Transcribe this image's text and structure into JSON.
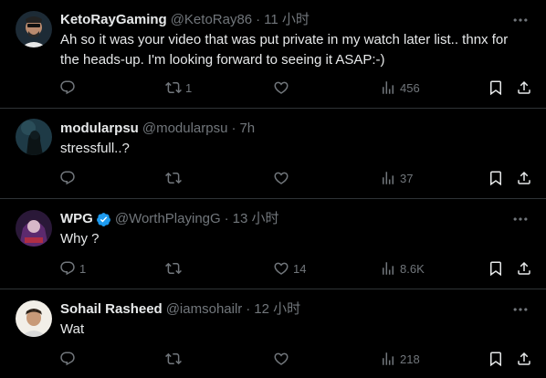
{
  "tweets": [
    {
      "name": "KetoRayGaming",
      "handle": "@KetoRay86",
      "separator": "·",
      "time": "11 小时",
      "text": "Ah so it was your video that was put private in my watch later list.. thnx for\nthe heads-up. I'm looking forward to seeing it ASAP:-)",
      "verified": false,
      "reply_count": "",
      "retweet_count": "1",
      "like_count": "",
      "view_count": "456"
    },
    {
      "name": "modularpsu",
      "handle": "@modularpsu",
      "separator": "·",
      "time": "7h",
      "text": "stressfull..?",
      "verified": false,
      "reply_count": "",
      "retweet_count": "",
      "like_count": "",
      "view_count": "37"
    },
    {
      "name": "WPG",
      "handle": "@WorthPlayingG",
      "separator": "·",
      "time": "13 小时",
      "text": "Why ?",
      "verified": true,
      "reply_count": "1",
      "retweet_count": "",
      "like_count": "14",
      "view_count": "8.6K"
    },
    {
      "name": "Sohail Rasheed",
      "handle": "@iamsohailr",
      "separator": "·",
      "time": "12 小时",
      "text": "Wat",
      "verified": false,
      "reply_count": "",
      "retweet_count": "",
      "like_count": "",
      "view_count": "218"
    }
  ],
  "icons": {
    "reply": "reply-icon",
    "retweet": "retweet-icon",
    "like": "heart-icon",
    "views": "views-icon",
    "bookmark": "bookmark-icon",
    "share": "share-icon",
    "more": "more-icon",
    "verified": "verified-badge-icon"
  },
  "colors": {
    "background": "#000000",
    "text": "#e7e9ea",
    "secondary": "#71767b",
    "divider": "#2f3336",
    "verified": "#1d9bf0"
  }
}
